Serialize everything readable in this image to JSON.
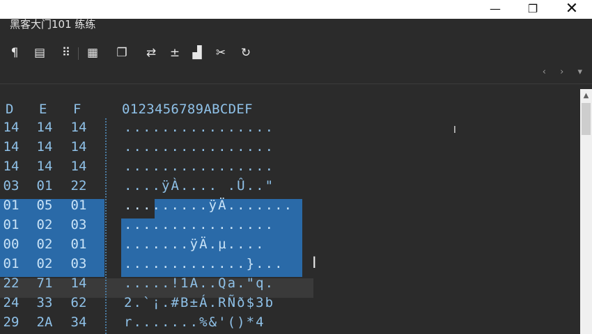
{
  "window": {
    "title": "黑客大门101 练练",
    "buttons": {
      "minimize": "—",
      "maximize": "❐",
      "close": "✕"
    }
  },
  "toolbar": {
    "icons": [
      {
        "name": "paragraph-icon",
        "glyph": "¶"
      },
      {
        "name": "columns-icon",
        "glyph": "▤"
      },
      {
        "name": "binary-icon",
        "glyph": "⠿"
      },
      {
        "name": "calculator-icon",
        "glyph": "▦"
      },
      {
        "name": "copy-icon",
        "glyph": "❐"
      },
      {
        "name": "transfer-icon",
        "glyph": "⇄"
      },
      {
        "name": "plus-minus-icon",
        "glyph": "±"
      },
      {
        "name": "histogram-icon",
        "glyph": "▟"
      },
      {
        "name": "tools-icon",
        "glyph": "✂"
      },
      {
        "name": "refresh-icon",
        "glyph": "↻"
      }
    ],
    "nav": {
      "prev": "‹",
      "next": "›",
      "menu": "▾"
    }
  },
  "hex": {
    "columns": [
      "D",
      "E",
      "F"
    ],
    "ascii_header": "0123456789ABCDEF",
    "rows": [
      {
        "h": [
          "14",
          "14",
          "14"
        ],
        "a": "................"
      },
      {
        "h": [
          "14",
          "14",
          "14"
        ],
        "a": "................"
      },
      {
        "h": [
          "14",
          "14",
          "14"
        ],
        "a": "................"
      },
      {
        "h": [
          "03",
          "01",
          "22"
        ],
        "a": "....ÿÀ.... .Û..\""
      },
      {
        "h": [
          "01",
          "05",
          "01"
        ],
        "a": ".........ÿÄ......."
      },
      {
        "h": [
          "01",
          "02",
          "03"
        ],
        "a": "................"
      },
      {
        "h": [
          "00",
          "02",
          "01"
        ],
        "a": ".......ÿÄ.µ...."
      },
      {
        "h": [
          "01",
          "02",
          "03"
        ],
        "a": ".............}..."
      },
      {
        "h": [
          "22",
          "71",
          "14"
        ],
        "a": ".....!1A..Qa.\"q."
      },
      {
        "h": [
          "24",
          "33",
          "62"
        ],
        "a": "2.`¡.#B±Á.RÑð$3b"
      },
      {
        "h": [
          "29",
          "2A",
          "34"
        ],
        "a": "r.......%&'()*4"
      }
    ]
  }
}
